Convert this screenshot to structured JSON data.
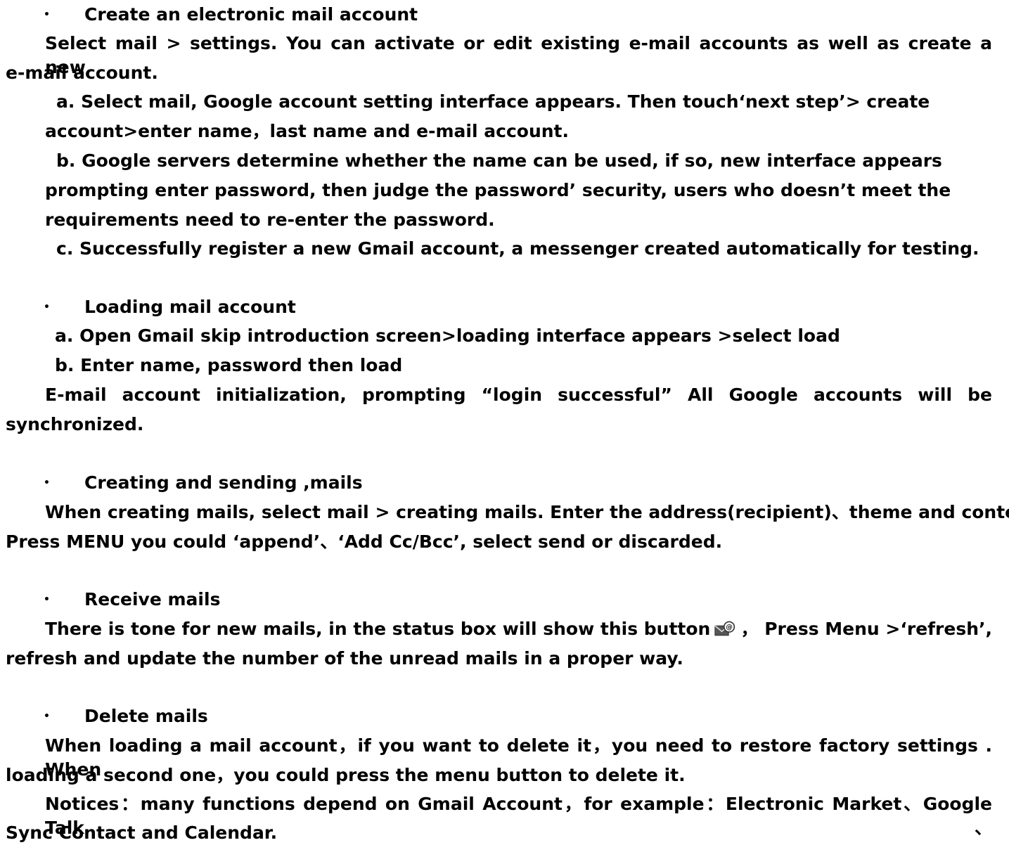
{
  "sections": [
    {
      "heading": "Create an electronic mail account",
      "intro": "Select mail > settings. You can activate or edit existing e-mail accounts as well as create a new",
      "intro_cont": "e-mail account.",
      "steps": [
        [
          "a.  Select mail, Google account setting interface appears. Then touch‘next step’> create",
          "account>enter name，last name and e-mail account."
        ],
        [
          "b.  Google servers determine whether the name can be used, if so, new interface appears",
          "prompting enter password, then judge the password’ security, users who doesn’t meet the",
          "requirements need to re-enter the password."
        ],
        [
          "c.  Successfully register a new Gmail account, a messenger created automatically for testing."
        ]
      ]
    },
    {
      "heading": "Loading mail account",
      "steps": [
        "a. Open Gmail skip introduction screen>loading interface appears >select load",
        "b. Enter name, password then load"
      ],
      "body": "E-mail account initialization, prompting “login successful” All Google accounts will be",
      "body_cont": "synchronized."
    },
    {
      "heading": "Creating and sending ,mails",
      "body": "When creating mails, select mail > creating mails. Enter the address(recipient)、theme and contents.",
      "body_cont": "Press MENU you could  ‘append’、‘Add Cc/Bcc’,   select send or discarded."
    },
    {
      "heading": "Receive mails",
      "body_before_icon": "There is tone for new mails, in the status box will show this button",
      "body_after_icon": "，   Press Menu >‘refresh’,",
      "body_cont": "refresh and update the number of the unread mails in a proper way.",
      "icon": "new-mail-icon"
    },
    {
      "heading": "Delete   mails",
      "body": "When loading a mail account，if you want to delete it，you need to restore factory settings . When",
      "body_cont": "loading a second one，you could press the menu button to delete it.",
      "notice": "Notices：many functions depend on Gmail Account，for example：Electronic Market、Google Talk、",
      "notice_cont": "Sync Contact and Calendar."
    }
  ],
  "bullet_char": "•"
}
